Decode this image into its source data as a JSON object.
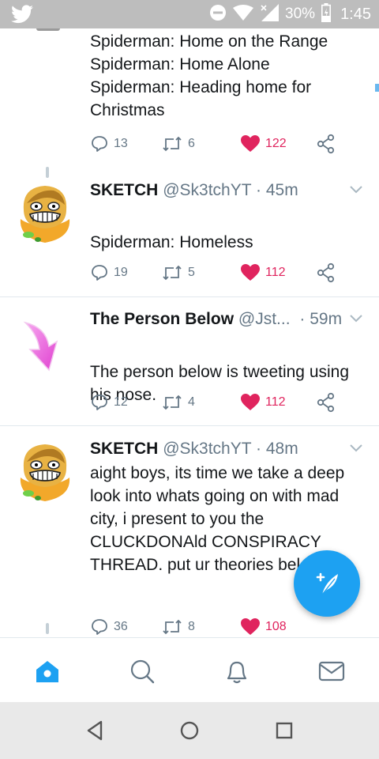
{
  "status_bar": {
    "battery": "30%",
    "time": "1:45"
  },
  "tweets": [
    {
      "text_lines": [
        "Spiderman: Home on the Range",
        "Spiderman: Home Alone",
        "Spiderman: Heading home for",
        "Christmas"
      ],
      "replies": "13",
      "retweets": "6",
      "likes": "122"
    },
    {
      "name": "SKETCH",
      "handle": "@Sk3tchYT",
      "dot": "·",
      "time": "45m",
      "text": "Spiderman: Homeless",
      "replies": "19",
      "retweets": "5",
      "likes": "112"
    },
    {
      "name": "The Person Below",
      "handle": "@Jst...",
      "dot": "·",
      "time": "59m",
      "text_lines": [
        "The person below is tweeting using",
        "his nose."
      ],
      "replies": "12",
      "retweets": "4",
      "likes": "112"
    },
    {
      "name": "SKETCH",
      "handle": "@Sk3tchYT",
      "dot": "·",
      "time": "48m",
      "text_lines": [
        "aight boys, its time we take a deep",
        "look into whats going on with mad",
        "city, i present to you the",
        "CLUCKDONAld CONSPIRACY",
        "THREAD. put ur theories bel"
      ],
      "replies": "36",
      "retweets": "8",
      "likes": "108"
    }
  ],
  "colors": {
    "accent": "#1da1f2",
    "like": "#e0245e",
    "muted": "#657786"
  },
  "icons": {
    "status": [
      "twitter-bird-icon",
      "do-not-disturb-icon",
      "wifi-icon",
      "signal-icon",
      "battery-icon"
    ],
    "actions": [
      "reply-icon",
      "retweet-icon",
      "like-heart-icon",
      "share-icon"
    ],
    "tabs": [
      "home-icon",
      "search-icon",
      "notifications-bell-icon",
      "messages-envelope-icon"
    ],
    "nav": [
      "back-triangle-icon",
      "home-circle-icon",
      "recents-square-icon"
    ],
    "fab": "compose-tweet-icon"
  }
}
